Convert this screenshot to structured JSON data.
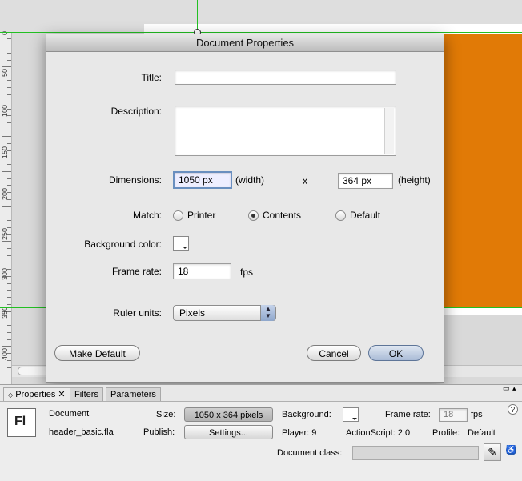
{
  "ruler": {
    "labels": [
      "0",
      "50",
      "100",
      "150",
      "200",
      "250",
      "300",
      "350",
      "400"
    ]
  },
  "dialog": {
    "title": "Document Properties",
    "title_label": "Title:",
    "title_value": "",
    "description_label": "Description:",
    "description_value": "",
    "dimensions_label": "Dimensions:",
    "width_value": "1050 px",
    "width_suffix": "(width)",
    "times": "x",
    "height_value": "364 px",
    "height_suffix": "(height)",
    "match_label": "Match:",
    "match_options": [
      "Printer",
      "Contents",
      "Default"
    ],
    "match_selected": "Contents",
    "background_label": "Background color:",
    "frame_rate_label": "Frame rate:",
    "frame_rate_value": "18",
    "frame_rate_unit": "fps",
    "ruler_units_label": "Ruler units:",
    "ruler_units_value": "Pixels",
    "make_default": "Make Default",
    "cancel": "Cancel",
    "ok": "OK"
  },
  "panel": {
    "tabs": [
      "Properties",
      "Filters",
      "Parameters"
    ],
    "active_tab": "Properties",
    "icon_text": "Fl",
    "doc_type": "Document",
    "file_name": "header_basic.fla",
    "size_label": "Size:",
    "size_value": "1050 x 364 pixels",
    "publish_label": "Publish:",
    "settings_button": "Settings...",
    "background_label": "Background:",
    "frame_rate_label": "Frame rate:",
    "frame_rate_value": "18",
    "fps": "fps",
    "player_label": "Player: 9",
    "actionscript_label": "ActionScript: 2.0",
    "profile_label": "Profile:",
    "profile_value": "Default",
    "doc_class_label": "Document class:",
    "doc_class_value": ""
  },
  "colors": {
    "stage_orange": "#e17a06",
    "guide_green": "#22c022",
    "default_button_blue": "#a9bbd6"
  }
}
